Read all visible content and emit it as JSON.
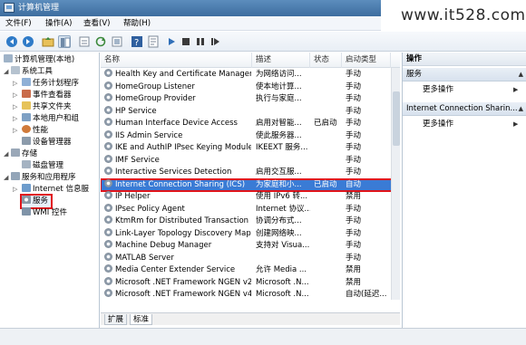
{
  "window": {
    "title": "计算机管理"
  },
  "watermark": "www.it528.com",
  "menu": [
    "文件(F)",
    "操作(A)",
    "查看(V)",
    "帮助(H)"
  ],
  "tree": {
    "root": "计算机管理(本地)",
    "system_tools": "系统工具",
    "task_scheduler": "任务计划程序",
    "event_viewer": "事件查看器",
    "shared_folders": "共享文件夹",
    "local_users": "本地用户和组",
    "performance": "性能",
    "device_manager": "设备管理器",
    "storage": "存储",
    "disk_management": "磁盘管理",
    "services_apps": "服务和应用程序",
    "iis": "Internet 信息服",
    "services": "服务",
    "wmi": "WMI 控件"
  },
  "columns": {
    "name": "名称",
    "desc": "描述",
    "status": "状态",
    "startup": "启动类型"
  },
  "services": [
    {
      "name": "Health Key and Certificate Manageme...",
      "desc": "为网络访问...",
      "status": "",
      "startup": "手动"
    },
    {
      "name": "HomeGroup Listener",
      "desc": "使本地计算...",
      "status": "",
      "startup": "手动"
    },
    {
      "name": "HomeGroup Provider",
      "desc": "执行与家庭...",
      "status": "",
      "startup": "手动"
    },
    {
      "name": "HP Service",
      "desc": "",
      "status": "",
      "startup": "手动"
    },
    {
      "name": "Human Interface Device Access",
      "desc": "启用对智能...",
      "status": "已启动",
      "startup": "手动"
    },
    {
      "name": "IIS Admin Service",
      "desc": "使此服务器...",
      "status": "",
      "startup": "手动"
    },
    {
      "name": "IKE and AuthIP IPsec Keying Modules",
      "desc": "IKEEXT 服务...",
      "status": "",
      "startup": "手动"
    },
    {
      "name": "IMF Service",
      "desc": "",
      "status": "",
      "startup": "手动"
    },
    {
      "name": "Interactive Services Detection",
      "desc": "启用交互服...",
      "status": "",
      "startup": "手动"
    },
    {
      "name": "Internet Connection Sharing (ICS)",
      "desc": "为家庭和小...",
      "status": "已启动",
      "startup": "自动"
    },
    {
      "name": "IP Helper",
      "desc": "使用 IPv6 转...",
      "status": "",
      "startup": "禁用"
    },
    {
      "name": "IPsec Policy Agent",
      "desc": "Internet 协议...",
      "status": "",
      "startup": "手动"
    },
    {
      "name": "KtmRm for Distributed Transaction C...",
      "desc": "协调分布式...",
      "status": "",
      "startup": "手动"
    },
    {
      "name": "Link-Layer Topology Discovery Mapper",
      "desc": "创建网络映...",
      "status": "",
      "startup": "手动"
    },
    {
      "name": "Machine Debug Manager",
      "desc": "支持对 Visua...",
      "status": "",
      "startup": "手动"
    },
    {
      "name": "MATLAB Server",
      "desc": "",
      "status": "",
      "startup": "手动"
    },
    {
      "name": "Media Center Extender Service",
      "desc": "允许 Media ...",
      "status": "",
      "startup": "禁用"
    },
    {
      "name": "Microsoft .NET Framework NGEN v2.0....",
      "desc": "Microsoft .N...",
      "status": "",
      "startup": "禁用"
    },
    {
      "name": "Microsoft .NET Framework NGEN v4.0....",
      "desc": "Microsoft .N...",
      "status": "",
      "startup": "自动(延迟..."
    }
  ],
  "tabs": [
    "扩展",
    "标准"
  ],
  "actions": {
    "header": "操作",
    "group1": "服务",
    "more1": "更多操作",
    "group2": "Internet Connection Sharin...",
    "more2": "更多操作"
  }
}
